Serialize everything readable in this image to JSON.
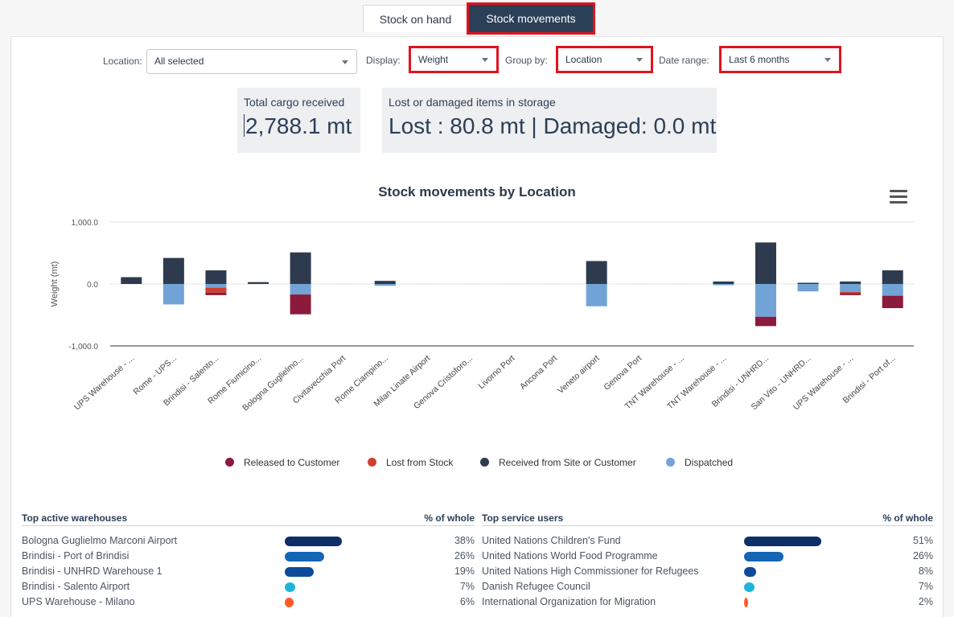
{
  "tabs": [
    {
      "label": "Stock on hand",
      "active": false
    },
    {
      "label": "Stock movements",
      "active": true
    }
  ],
  "filters": {
    "location": {
      "label": "Location:",
      "value": "All selected"
    },
    "display": {
      "label": "Display:",
      "value": "Weight"
    },
    "group_by": {
      "label": "Group by:",
      "value": "Location"
    },
    "date_range": {
      "label": "Date range:",
      "value": "Last 6 months"
    }
  },
  "kpis": {
    "total_cargo": {
      "title": "Total cargo received",
      "value": "2,788.1 mt"
    },
    "lost_damaged": {
      "title": "Lost or damaged items in storage",
      "value": "Lost : 80.8 mt | Damaged: 0.0 mt"
    }
  },
  "chart_data": {
    "type": "bar",
    "stacked": true,
    "title": "Stock movements by Location",
    "ylabel": "Weight (mt)",
    "xlabel": "",
    "ylim": [
      -1000,
      1000
    ],
    "yticks": [
      1000,
      0,
      -1000
    ],
    "ytick_labels": [
      "1,000.0",
      "0.0",
      "-1,000.0"
    ],
    "categories": [
      "UPS Warehouse - ...",
      "Rome - UPS...",
      "Brindisi - Salento...",
      "Rome Fiumicino...",
      "Bologna Guglielmo...",
      "Civitavecchia Port",
      "Rome Ciampino...",
      "Milan Linate Airport",
      "Genova Cristoforo...",
      "Livorno Port",
      "Ancona Port",
      "Veneto airport",
      "Genova Port",
      "TNT Warehouse - ...",
      "TNT Warehouse - ...",
      "Brindisi - UNHRD...",
      "San Vito - UNHRD...",
      "UPS Warehouse - ...",
      "Brindisi - Port of..."
    ],
    "series": [
      {
        "name": "Released to Customer",
        "color": "#8b1a3c",
        "values": [
          0,
          0,
          -40,
          0,
          -320,
          0,
          0,
          0,
          0,
          0,
          0,
          0,
          0,
          0,
          0,
          -150,
          0,
          -30,
          -200
        ]
      },
      {
        "name": "Lost from Stock",
        "color": "#d0402e",
        "values": [
          0,
          0,
          -80,
          0,
          0,
          0,
          0,
          0,
          0,
          0,
          0,
          0,
          0,
          0,
          0,
          0,
          0,
          -20,
          0
        ]
      },
      {
        "name": "Received from Site or Customer",
        "color": "#2e3b4e",
        "values": [
          110,
          420,
          220,
          30,
          510,
          0,
          50,
          0,
          0,
          0,
          0,
          370,
          0,
          0,
          40,
          670,
          20,
          40,
          220
        ]
      },
      {
        "name": "Dispatched",
        "color": "#72a3d6",
        "values": [
          0,
          -330,
          -60,
          0,
          -170,
          0,
          -30,
          0,
          0,
          0,
          0,
          -360,
          0,
          0,
          -20,
          -530,
          -120,
          -130,
          -190
        ]
      }
    ],
    "legend": "bottom",
    "grid": true
  },
  "top_warehouses": {
    "title": "Top active warehouses",
    "pct_header": "% of whole",
    "rows": [
      {
        "name": "Bologna Guglielmo Marconi Airport",
        "pct": "38%",
        "value": 38,
        "color": "#0b2f66"
      },
      {
        "name": "Brindisi - Port of Brindisi",
        "pct": "26%",
        "value": 26,
        "color": "#1565b5"
      },
      {
        "name": "Brindisi - UNHRD Warehouse 1",
        "pct": "19%",
        "value": 19,
        "color": "#0d4a9a"
      },
      {
        "name": "Brindisi - Salento Airport",
        "pct": "7%",
        "value": 7,
        "color": "#1fb5d8"
      },
      {
        "name": "UPS Warehouse - Milano",
        "pct": "6%",
        "value": 6,
        "color": "#ff5a2a"
      }
    ]
  },
  "top_users": {
    "title": "Top service users",
    "pct_header": "% of whole",
    "rows": [
      {
        "name": "United Nations Children's Fund",
        "pct": "51%",
        "value": 51,
        "color": "#0b2f66"
      },
      {
        "name": "United Nations World Food Programme",
        "pct": "26%",
        "value": 26,
        "color": "#1565b5"
      },
      {
        "name": "United Nations High Commissioner for Refugees",
        "pct": "8%",
        "value": 8,
        "color": "#0d4a9a"
      },
      {
        "name": "Danish Refugee Council",
        "pct": "7%",
        "value": 7,
        "color": "#1fb5d8"
      },
      {
        "name": "International Organization for Migration",
        "pct": "2%",
        "value": 2,
        "color": "#ff5a2a"
      }
    ]
  }
}
